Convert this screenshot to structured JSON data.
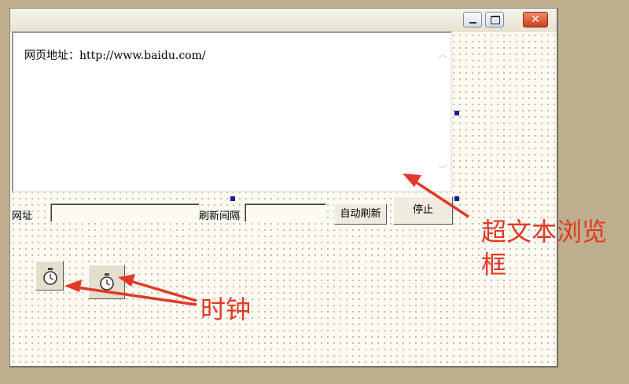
{
  "titlebar": {
    "minimize_icon": "minimize-icon",
    "maximize_icon": "maximize-icon",
    "close_icon": "close-icon",
    "close_glyph": "✕"
  },
  "browser": {
    "content_text": "网页地址：http://www.baidu.com/",
    "scroll_up_glyph": "︿",
    "scroll_down_glyph": "﹀"
  },
  "form": {
    "url_label": "网址",
    "url_value": "",
    "interval_label": "刷新间隔",
    "interval_value": "",
    "auto_refresh_button": "自动刷新",
    "stop_button": "停止"
  },
  "timers": [
    {
      "icon": "stopwatch-icon"
    },
    {
      "icon": "stopwatch-icon"
    }
  ],
  "annotations": {
    "browser_label": "超文本浏览框",
    "timer_label": "时钟",
    "color": "#e03a26"
  }
}
